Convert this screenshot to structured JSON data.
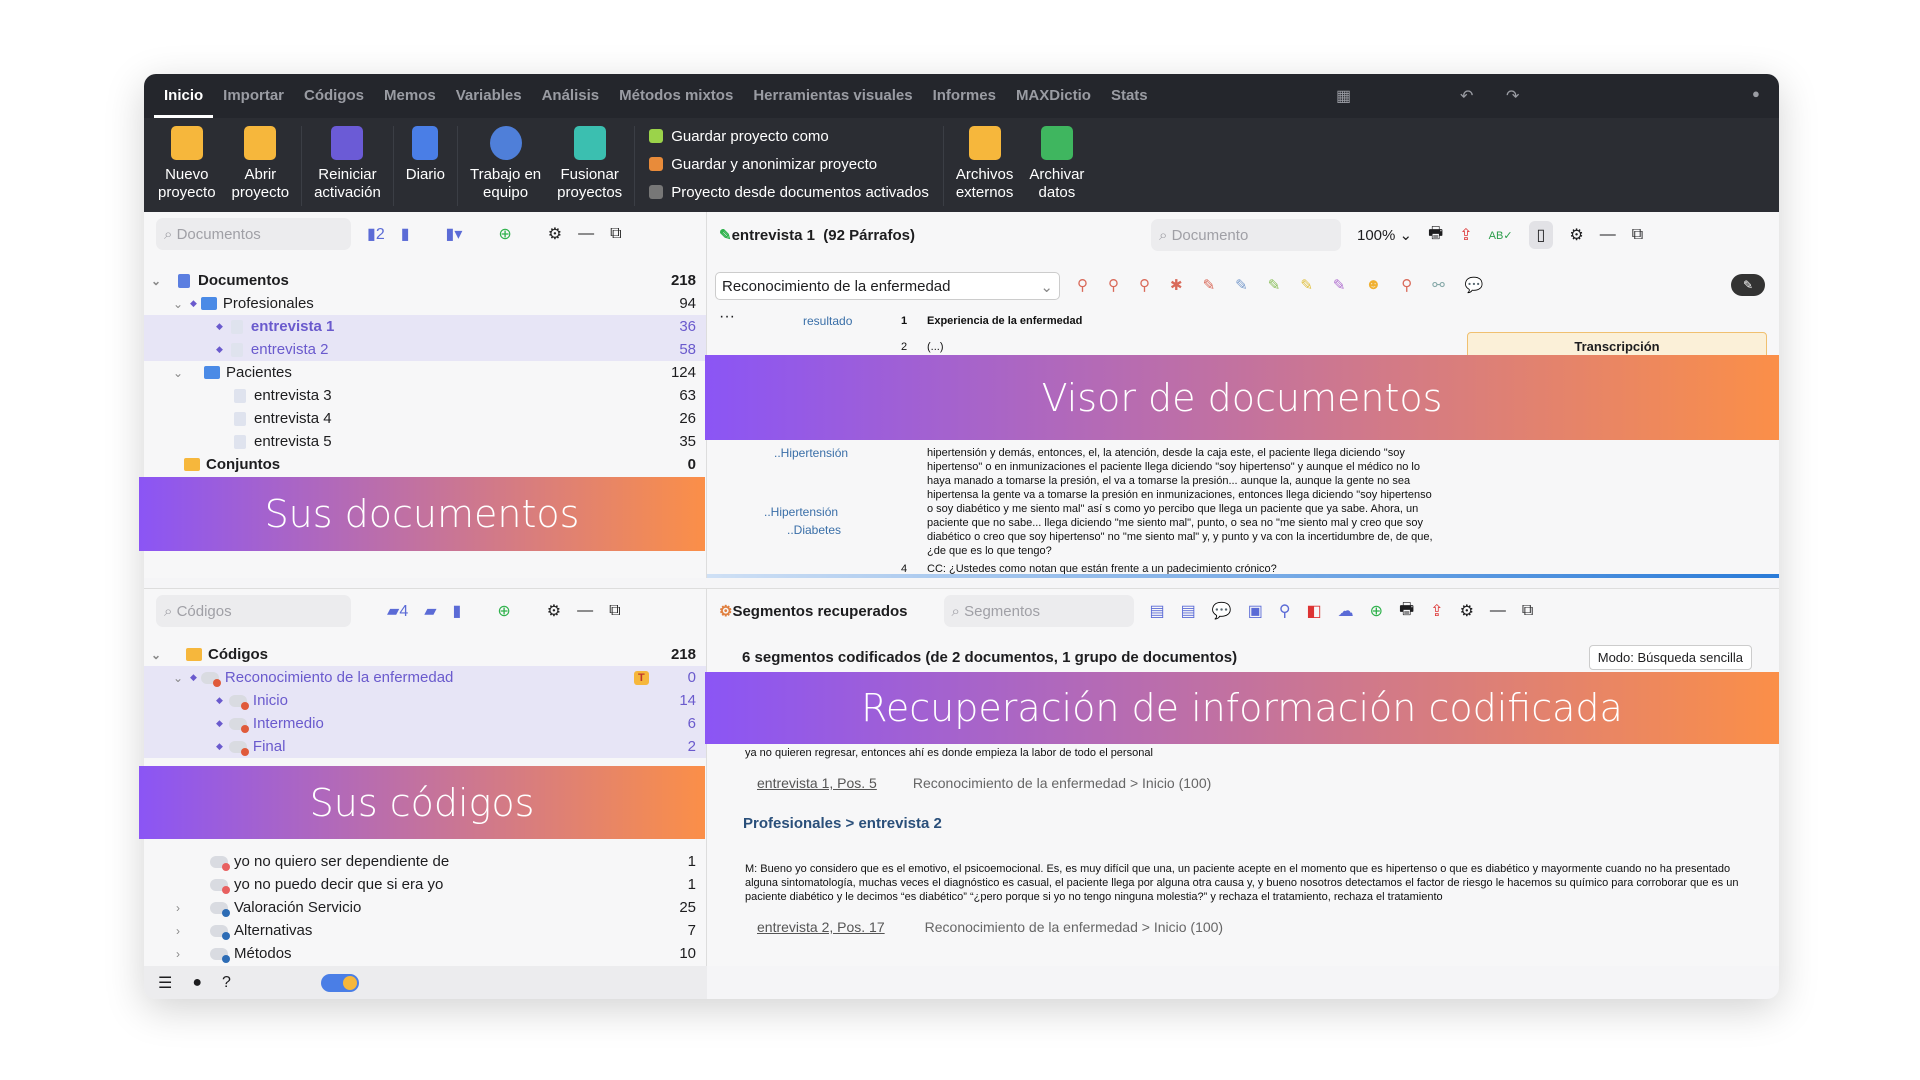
{
  "menu_tabs": [
    "Inicio",
    "Importar",
    "Códigos",
    "Memos",
    "Variables",
    "Análisis",
    "Métodos mixtos",
    "Herramientas visuales",
    "Informes",
    "MAXDictio",
    "Stats"
  ],
  "ribbon": {
    "nuevo": "Nuevo\nproyecto",
    "abrir": "Abrir\nproyecto",
    "reiniciar": "Reiniciar\nactivación",
    "diario": "Diario",
    "trabajo": "Trabajo en\nequipo",
    "fusionar": "Fusionar\nproyectos",
    "list": [
      "Guardar proyecto como",
      "Guardar y anonimizar proyecto",
      "Proyecto desde documentos activados"
    ],
    "archivos": "Archivos\nexternos",
    "archivar": "Archivar\ndatos"
  },
  "documents": {
    "search_placeholder": "Documentos",
    "active_count": "2",
    "rows": [
      {
        "label": "Documentos",
        "count": "218"
      },
      {
        "label": "Profesionales",
        "count": "94"
      },
      {
        "label": "entrevista 1",
        "count": "36"
      },
      {
        "label": "entrevista 2",
        "count": "58"
      },
      {
        "label": "Pacientes",
        "count": "124"
      },
      {
        "label": "entrevista 3",
        "count": "63"
      },
      {
        "label": "entrevista 4",
        "count": "26"
      },
      {
        "label": "entrevista 5",
        "count": "35"
      },
      {
        "label": "Conjuntos",
        "count": "0"
      }
    ]
  },
  "codes": {
    "search_placeholder": "Códigos",
    "active_count": "4",
    "rows": [
      {
        "label": "Códigos",
        "count": "218"
      },
      {
        "label": "Reconocimiento de la enfermedad",
        "count": "0"
      },
      {
        "label": "Inicio",
        "count": "14"
      },
      {
        "label": "Intermedio",
        "count": "6"
      },
      {
        "label": "Final",
        "count": "2"
      },
      {
        "label": "yo no quiero ser dependiente de",
        "count": "1"
      },
      {
        "label": "yo no puedo decir que si era yo",
        "count": "1"
      },
      {
        "label": "Valoración Servicio",
        "count": "25"
      },
      {
        "label": "Alternativas",
        "count": "7"
      },
      {
        "label": "Métodos",
        "count": "10"
      }
    ]
  },
  "viewer": {
    "title": "entrevista 1  (92 Párrafos)",
    "search_placeholder": "Documento",
    "zoom": "100%",
    "code_select": "Reconocimiento de la enfermedad",
    "code_labels": [
      "resultado",
      "..Hipertensión",
      "..Hipertensión",
      "..Diabetes"
    ],
    "paragraphs": [
      {
        "n": "1",
        "text": "Experiencia de la enfermedad"
      },
      {
        "n": "2",
        "text": "(...)"
      },
      {
        "n": "",
        "text": "hipertensión y demás, entonces, el, la atención, desde la caja este, el paciente llega diciendo \"soy hipertenso\" o en inmunizaciones el paciente llega diciendo \"soy hipertenso\" y aunque el médico no lo haya manado a tomarse la presión, el va a tomarse la presión... aunque la, aunque la gente no sea hipertensa la gente va a tomarse la presión en inmunizaciones, entonces llega diciendo \"soy hipertenso o soy diabético y me siento mal\" así s como yo percibo que llega un paciente que ya sabe. Ahora, un paciente que no sabe... llega diciendo \"me siento mal\", punto, o sea no \"me siento mal y creo que soy diabético o creo que soy hipertenso\" no \"me siento mal\" y, y punto y va con la incertidumbre de, de que, ¿de que es lo que tengo?"
      },
      {
        "n": "4",
        "text": "CC: ¿Ustedes como notan que están frente a un padecimiento crónico?"
      }
    ],
    "memo_title": "Transcripción"
  },
  "retrieval": {
    "title": "Segmentos recuperados",
    "search_placeholder": "Segmentos",
    "summary": "6 segmentos codificados (de 2 documentos, 1 grupo de documentos)",
    "mode": "Modo: Búsqueda sencilla",
    "seg1_text": "ya no quieren regresar, entonces ahí es donde empieza la labor de todo el personal",
    "seg1_src": "entrevista 1, Pos. 5",
    "seg1_code": "Reconocimiento de la enfermedad > Inicio (100)",
    "group2": "Profesionales > entrevista 2",
    "seg2_text": "M: Bueno yo considero que es el emotivo, el psicoemocional. Es, es muy difícil que una, un paciente acepte en el momento que es hipertenso o que es diabético y mayormente cuando no ha presentado alguna sintomatología, muchas veces el diagnóstico es casual, el paciente llega por alguna otra causa y, y bueno nosotros detectamos el factor de riesgo le hacemos su químico para corroborar que es un paciente diabético y le decimos “es diabético” “¿pero porque si yo no tengo ninguna molestia?” y rechaza el tratamiento, rechaza el tratamiento",
    "seg2_src": "entrevista 2, Pos. 17",
    "seg2_code": "Reconocimiento de la enfermedad > Inicio (100)"
  },
  "overlays": {
    "documents": "Sus documentos",
    "viewer": "Visor de documentos",
    "retrieval": "Recuperación de información codificada",
    "codes": "Sus códigos"
  },
  "colors": {
    "gradient_start": "#8b55f5",
    "gradient_end": "#fb8f48",
    "selection": "#e7e5f6",
    "accent": "#6a5acd",
    "dark_bar": "#24262c"
  }
}
